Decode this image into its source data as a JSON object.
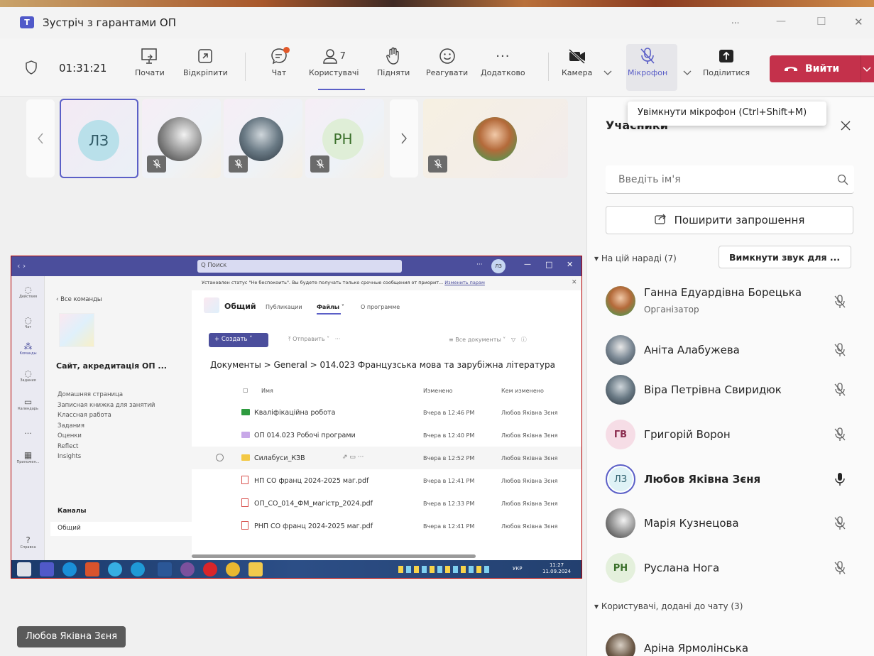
{
  "window": {
    "title": "Зустріч з гарантами ОП",
    "more": "...",
    "minimize": "—",
    "maximize": "☐",
    "close": "✕"
  },
  "toolbar": {
    "timer": "01:31:21",
    "start_label": "Почати",
    "unpin_label": "Відкріпити",
    "chat_label": "Чат",
    "users_label": "Користувачі",
    "users_count": "7",
    "raise_label": "Підняти",
    "react_label": "Реагувати",
    "more_label": "Додатково",
    "camera_label": "Камера",
    "mic_label": "Мікрофон",
    "share_label": "Поділитися",
    "leave_label": "Вийти",
    "accent": "#c4314b",
    "active_color": "#5b5fc7"
  },
  "tooltip": "Увімкнути мікрофон (Ctrl+Shift+M)",
  "gallery": {
    "tiles": [
      {
        "initials": "ЛЗ"
      },
      {
        "initials": ""
      },
      {
        "initials": ""
      },
      {
        "initials": "РН"
      },
      {
        "initials": ""
      }
    ]
  },
  "panel": {
    "title": "Учасники",
    "search_placeholder": "Введіть ім'я",
    "invite_label": "Поширити запрошення",
    "in_meeting": "На цій нараді (7)",
    "mute_all": "Вимкнути звук для ...",
    "participants": [
      {
        "name": "Ганна Едуардівна Борецька",
        "role": "Організатор",
        "initials": ""
      },
      {
        "name": "Аніта Алабужева",
        "role": "",
        "initials": ""
      },
      {
        "name": "Віра Петрівна Свиридюк",
        "role": "",
        "initials": ""
      },
      {
        "name": "Григорій Ворон",
        "role": "",
        "initials": "ГВ"
      },
      {
        "name": "Любов Яківна Зєня",
        "role": "",
        "initials": "ЛЗ"
      },
      {
        "name": "Марія Кузнецова",
        "role": "",
        "initials": ""
      },
      {
        "name": "Руслана Нога",
        "role": "",
        "initials": "РН"
      }
    ],
    "chat_added": "Користувачі, додані до чату (3)",
    "chat_users": [
      {
        "name": "Аріна Ярмолінська"
      }
    ]
  },
  "presenter_label": "Любов Яківна Зєня",
  "share": {
    "search": "Q Поиск",
    "avatar": "ЛЗ",
    "rail": [
      "Действия",
      "Чат",
      "Команды",
      "Задания",
      "Календарь",
      "...",
      "Приложен...",
      "Справка"
    ],
    "back": "Все команды",
    "team_name": "Сайт, акредитація ОП ...",
    "nav": [
      "Домашняя страница",
      "Записная книжка для занятий",
      "Классная работа",
      "Задания",
      "Оценки",
      "Reflect",
      "Insights"
    ],
    "channels_label": "Каналы",
    "channel": "Общий",
    "banner": "Установлен статус \"Не беспокоить\". Вы будете получать только срочные сообщения от приорит...",
    "banner_link": "Изменить парам",
    "channel_title": "Общий",
    "tabs": [
      "Публикации",
      "Файлы",
      "О программе"
    ],
    "create": "+ Создать",
    "send": "Отправить",
    "all_docs": "Все документы",
    "breadcrumb": "Документы > General > 014.023 Французська мова та зарубіжна література",
    "col_name": "Имя",
    "col_modified": "Изменено",
    "col_by": "Кем изменено",
    "files": [
      {
        "name": "Кваліфікаційна робота",
        "date": "Вчера в 12:46 PM",
        "by": "Любов Яківна Зєня",
        "kind": "folder-green"
      },
      {
        "name": "ОП 014.023 Робочі програми",
        "date": "Вчера в 12:40 PM",
        "by": "Любов Яківна Зєня",
        "kind": "folder-purple"
      },
      {
        "name": "Силабуси_КЗВ",
        "date": "Вчера в 12:52 PM",
        "by": "Любов Яківна Зєня",
        "kind": "folder-yellow"
      },
      {
        "name": "НП СО франц 2024-2025 маг.pdf",
        "date": "Вчера в 12:41 PM",
        "by": "Любов Яківна Зєня",
        "kind": "pdf"
      },
      {
        "name": "ОП_СО_014_ФМ_магістр_2024.pdf",
        "date": "Вчера в 12:33 PM",
        "by": "Любов Яківна Зєня",
        "kind": "pdf"
      },
      {
        "name": "РНП СО франц 2024-2025 маг.pdf",
        "date": "Вчера в 12:41 PM",
        "by": "Любов Яківна Зєня",
        "kind": "pdf"
      }
    ],
    "clock_time": "11:27",
    "clock_date": "11.09.2024",
    "lang": "УКР"
  }
}
